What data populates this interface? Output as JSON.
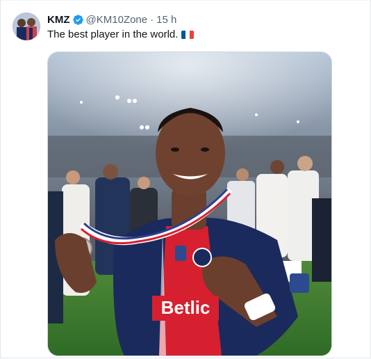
{
  "tweet": {
    "author_name": "KMZ",
    "handle": "@KM10Zone",
    "separator": "·",
    "time": "15 h",
    "text": "The best player in the world.",
    "flag": "french-flag",
    "verified": true
  },
  "photo": {
    "jersey_sponsor": "Betlic"
  },
  "colors": {
    "verified_blue": "#1d9bf0",
    "psg_navy": "#1b2a5c",
    "psg_red": "#d6202f",
    "flag_blue": "#0055a4",
    "flag_red": "#ef4135"
  }
}
